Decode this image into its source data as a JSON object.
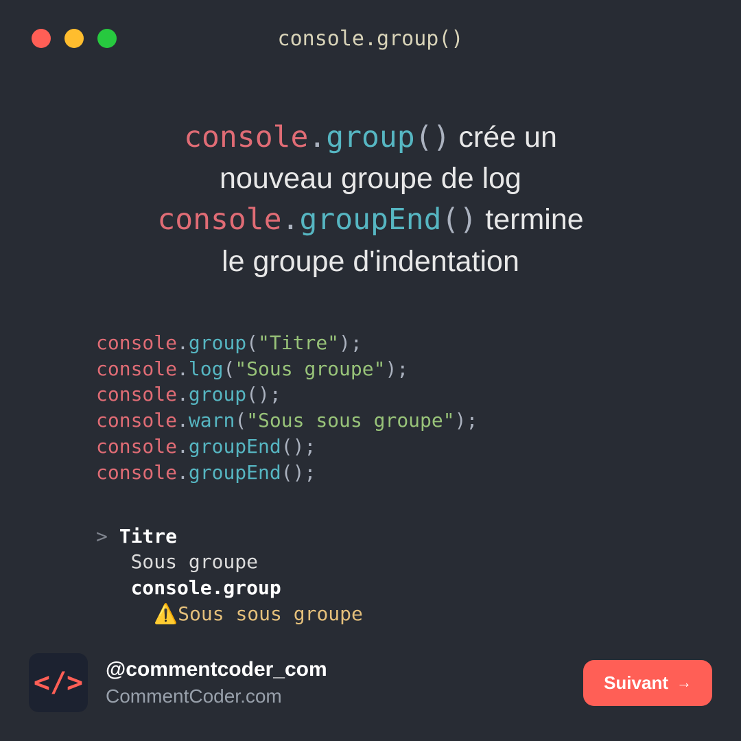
{
  "window": {
    "title": "console.group()"
  },
  "headline": {
    "line1_obj": "console",
    "line1_dot": ".",
    "line1_method": "group",
    "line1_paren_open": "(",
    "line1_paren_close": ")",
    "line1_rest": " crée un",
    "line2": "nouveau groupe de log",
    "line3_obj": "console",
    "line3_dot": ".",
    "line3_method": "groupEnd",
    "line3_paren_open": "(",
    "line3_paren_close": ")",
    "line3_rest": " termine",
    "line4": "le groupe d'indentation"
  },
  "code": {
    "lines": [
      {
        "obj": "console",
        "dot": ".",
        "method": "group",
        "open": "(",
        "arg": "\"Titre\"",
        "close": ");"
      },
      {
        "obj": "console",
        "dot": ".",
        "method": "log",
        "open": "(",
        "arg": "\"Sous groupe\"",
        "close": ");"
      },
      {
        "obj": "console",
        "dot": ".",
        "method": "group",
        "open": "(",
        "arg": "",
        "close": ");"
      },
      {
        "obj": "console",
        "dot": ".",
        "method": "warn",
        "open": "(",
        "arg": "\"Sous sous groupe\"",
        "close": ");"
      },
      {
        "obj": "console",
        "dot": ".",
        "method": "groupEnd",
        "open": "(",
        "arg": "",
        "close": ");"
      },
      {
        "obj": "console",
        "dot": ".",
        "method": "groupEnd",
        "open": "(",
        "arg": "",
        "close": ");"
      }
    ]
  },
  "output": {
    "chevron": ">",
    "title": "Titre",
    "sub": "Sous groupe",
    "groupLabel": "console.group",
    "warnIcon": "⚠️",
    "warnText": "Sous sous groupe"
  },
  "footer": {
    "logo": "</>",
    "handle": "@commentcoder_com",
    "site": "CommentCoder.com",
    "next": "Suivant",
    "arrow": "→"
  }
}
